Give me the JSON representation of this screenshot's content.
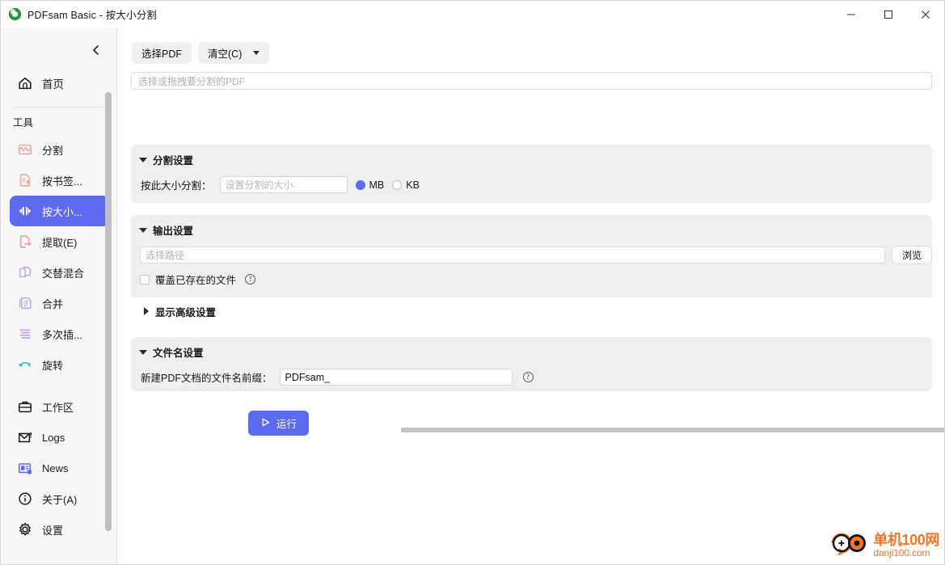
{
  "window": {
    "title": "PDFsam Basic - 按大小分割",
    "logo_icon": "pdfsam-logo-icon",
    "controls": {
      "minimize": "minimize-icon",
      "maximize": "maximize-icon",
      "close": "close-icon"
    }
  },
  "sidebar": {
    "collapse_icon": "chevron-left-icon",
    "home": {
      "label": "首页",
      "icon": "home-icon"
    },
    "tools_label": "工具",
    "tools": [
      {
        "label": "分割",
        "icon": "split-icon",
        "color": "#efa9a9",
        "active": false
      },
      {
        "label": "按书签...",
        "icon": "split-by-bookmarks-icon",
        "color": "#efa9a9",
        "active": false
      },
      {
        "label": "按大小...",
        "icon": "split-by-size-icon",
        "color": "#ffffff",
        "active": true
      },
      {
        "label": "提取(E)",
        "icon": "extract-icon",
        "color": "#ef9a9a",
        "active": false
      },
      {
        "label": "交替混合",
        "icon": "alternate-mix-icon",
        "color": "#b9a6e8",
        "active": false
      },
      {
        "label": "合并",
        "icon": "merge-icon",
        "color": "#b9a6e8",
        "active": false
      },
      {
        "label": "多次插...",
        "icon": "multi-insert-icon",
        "color": "#b9a6e8",
        "active": false
      },
      {
        "label": "旋转",
        "icon": "rotate-icon",
        "color": "#3fb8a8",
        "active": false
      }
    ],
    "bottom": [
      {
        "label": "工作区",
        "icon": "workspace-briefcase-icon"
      },
      {
        "label": "Logs",
        "icon": "logs-envelope-icon"
      },
      {
        "label": "News",
        "icon": "news-icon"
      },
      {
        "label": "关于(A)",
        "icon": "info-circle-icon"
      },
      {
        "label": "设置",
        "icon": "gear-icon"
      }
    ],
    "active_accent": "#5c6bf0"
  },
  "toolbar": {
    "select_pdf_label": "选择PDF",
    "clear_label": "清空(C)",
    "clear_caret_icon": "caret-down-icon"
  },
  "dropzone": {
    "placeholder": "选择或拖拽要分割的PDF"
  },
  "split_settings": {
    "title": "分割设置",
    "expand_icon": "triangle-down-icon",
    "size_label": "按此大小分割：",
    "size_placeholder": "设置分割的大小",
    "size_value": "",
    "units": [
      {
        "label": "MB",
        "selected": true
      },
      {
        "label": "KB",
        "selected": false
      }
    ]
  },
  "output_settings": {
    "title": "输出设置",
    "expand_icon": "triangle-down-icon",
    "path_placeholder": "选择路径",
    "path_value": "",
    "browse_label": "浏览",
    "overwrite_label": "覆盖已存在的文件",
    "overwrite_checked": false,
    "overwrite_help_icon": "question-circle-icon",
    "advanced_label": "显示高级设置",
    "advanced_icon": "triangle-right-icon"
  },
  "filename_settings": {
    "title": "文件名设置",
    "expand_icon": "triangle-down-icon",
    "prefix_label": "新建PDF文档的文件名前缀：",
    "prefix_value": "PDFsam_",
    "prefix_help_icon": "question-circle-icon"
  },
  "run": {
    "label": "运行",
    "icon": "play-triangle-icon",
    "progress_percent": 0
  },
  "watermark": {
    "icon": "danji-logo-icon",
    "title": "单机100网",
    "subtitle": "danji100.com",
    "color": "#f2752a"
  }
}
